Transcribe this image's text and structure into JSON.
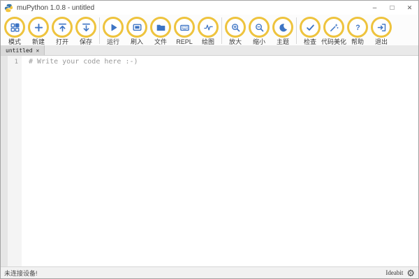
{
  "colors": {
    "ring_yellow": "#eec33d",
    "icon_blue": "#3d74c4"
  },
  "titlebar": {
    "title": "muPython 1.0.8 - untitled",
    "minimize": "–",
    "maximize": "□",
    "close": "✕"
  },
  "toolbar": {
    "separators_after": [
      3,
      8,
      11
    ],
    "buttons": [
      {
        "id": "mode",
        "label": "模式"
      },
      {
        "id": "new",
        "label": "新建"
      },
      {
        "id": "open",
        "label": "打开"
      },
      {
        "id": "save",
        "label": "保存"
      },
      {
        "id": "run",
        "label": "运行"
      },
      {
        "id": "flash",
        "label": "刷入"
      },
      {
        "id": "files",
        "label": "文件"
      },
      {
        "id": "repl",
        "label": "REPL"
      },
      {
        "id": "plotter",
        "label": "绘图"
      },
      {
        "id": "zoom-in",
        "label": "放大"
      },
      {
        "id": "zoom-out",
        "label": "缩小"
      },
      {
        "id": "theme",
        "label": "主题"
      },
      {
        "id": "check",
        "label": "检查"
      },
      {
        "id": "tidy",
        "label": "代码美化"
      },
      {
        "id": "help",
        "label": "帮助"
      },
      {
        "id": "quit",
        "label": "退出"
      }
    ]
  },
  "tab": {
    "label": "untitled",
    "close": "✕"
  },
  "editor": {
    "line_number": "1",
    "code": "# Write your code here :-)"
  },
  "statusbar": {
    "device_status": "未连接设备!",
    "brand": "Ideabit",
    "gear_icon": "⚙"
  }
}
